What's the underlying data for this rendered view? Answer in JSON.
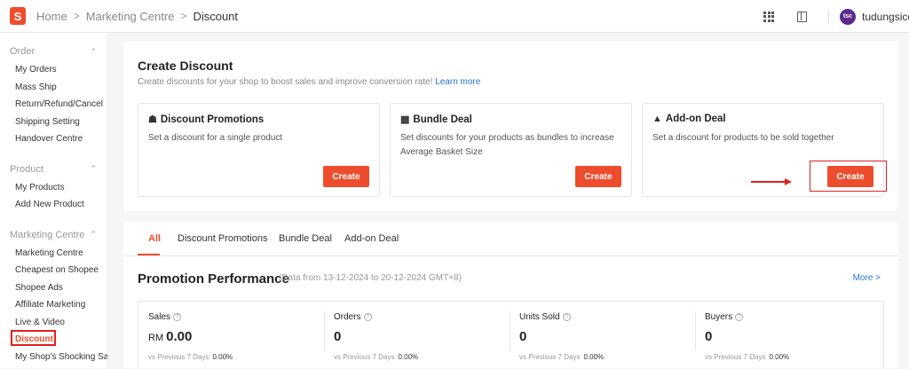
{
  "header": {
    "logo_letter": "S",
    "breadcrumbs": [
      "Home",
      "Marketing Centre",
      "Discount"
    ],
    "username": "tudungsicom",
    "avatar_text": "tsc"
  },
  "sidebar": {
    "groups": [
      {
        "title": "Order",
        "items": [
          "My Orders",
          "Mass Ship",
          "Return/Refund/Cancel",
          "Shipping Setting",
          "Handover Centre"
        ]
      },
      {
        "title": "Product",
        "items": [
          "My Products",
          "Add New Product"
        ]
      },
      {
        "title": "Marketing Centre",
        "items": [
          "Marketing Centre",
          "Cheapest on Shopee",
          "Shopee Ads",
          "Affiliate Marketing",
          "Live & Video",
          "Discount",
          "My Shop's Shocking Sale"
        ]
      }
    ]
  },
  "create": {
    "title": "Create Discount",
    "subtitle": "Create discounts for your shop to boost sales and improve conversion rate!",
    "learn_more": "Learn more",
    "deals": [
      {
        "title": "Discount Promotions",
        "desc": "Set a discount for a single product",
        "button": "Create"
      },
      {
        "title": "Bundle Deal",
        "desc": "Set discounts for your products as bundles to increase Average Basket Size",
        "button": "Create"
      },
      {
        "title": "Add-on Deal",
        "desc": "Set a discount for products to be sold together",
        "button": "Create"
      }
    ]
  },
  "performance": {
    "tabs": [
      "All",
      "Discount Promotions",
      "Bundle Deal",
      "Add-on Deal"
    ],
    "title": "Promotion Performance",
    "range": "(Data from 13-12-2024 to 20-12-2024 GMT+8)",
    "more": "More >",
    "metrics": [
      {
        "label": "Sales",
        "currency": "RM",
        "value": "0.00",
        "vs_label": "vs Previous 7 Days",
        "vs_value": "0.00%"
      },
      {
        "label": "Orders",
        "currency": "",
        "value": "0",
        "vs_label": "vs Previous 7 Days",
        "vs_value": "0.00%"
      },
      {
        "label": "Units Sold",
        "currency": "",
        "value": "0",
        "vs_label": "vs Previous 7 Days",
        "vs_value": "0.00%"
      },
      {
        "label": "Buyers",
        "currency": "",
        "value": "0",
        "vs_label": "vs Previous 7 Days",
        "vs_value": "0.00%"
      }
    ]
  },
  "colors": {
    "accent": "#ee4d2d",
    "link": "#2673dd",
    "annotation": "#e02020"
  }
}
